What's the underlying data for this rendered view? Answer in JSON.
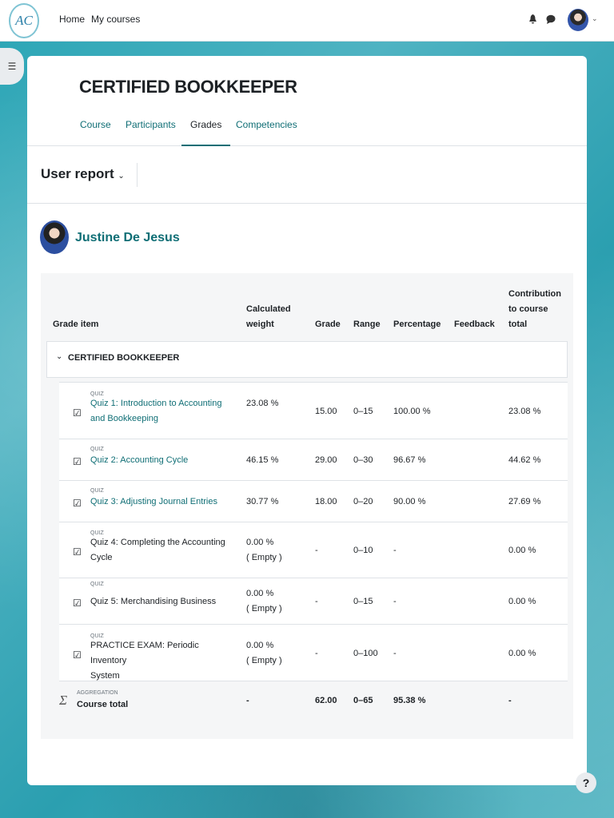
{
  "nav": {
    "logo_text": "AC",
    "home": "Home",
    "my_courses": "My courses",
    "caret": "⌄"
  },
  "drawer_icon": "☰",
  "course": {
    "title": "CERTIFIED BOOKKEEPER",
    "tabs": [
      "Course",
      "Participants",
      "Grades",
      "Competencies"
    ],
    "active_tab": "Grades"
  },
  "report": {
    "label": "User report",
    "chevron": "⌄"
  },
  "user": {
    "name": "Justine De Jesus"
  },
  "table": {
    "headers": {
      "item": "Grade item",
      "weight": [
        "Calculated",
        "weight"
      ],
      "grade": "Grade",
      "range": "Range",
      "percentage": "Percentage",
      "feedback": "Feedback",
      "contribution": [
        "Contribution",
        "to course",
        "total"
      ]
    },
    "category": "CERTIFIED BOOKKEEPER",
    "rows": [
      {
        "type": "QUIZ",
        "name": [
          "Quiz 1: Introduction to Accounting",
          "and Bookkeeping"
        ],
        "link": true,
        "weight": [
          "23.08 %",
          ""
        ],
        "grade": "15.00",
        "range": "0–15",
        "percentage": "100.00 %",
        "feedback": "",
        "contribution": "23.08 %"
      },
      {
        "type": "QUIZ",
        "name": [
          "Quiz 2: Accounting Cycle",
          ""
        ],
        "link": true,
        "weight": [
          "46.15 %",
          ""
        ],
        "grade": "29.00",
        "range": "0–30",
        "percentage": "96.67 %",
        "feedback": "",
        "contribution": "44.62 %"
      },
      {
        "type": "QUIZ",
        "name": [
          "Quiz 3: Adjusting Journal Entries",
          ""
        ],
        "link": true,
        "weight": [
          "30.77 %",
          ""
        ],
        "grade": "18.00",
        "range": "0–20",
        "percentage": "90.00 %",
        "feedback": "",
        "contribution": "27.69 %"
      },
      {
        "type": "QUIZ",
        "name": [
          "Quiz 4: Completing the Accounting",
          "Cycle"
        ],
        "link": false,
        "weight": [
          "0.00 %",
          "( Empty )"
        ],
        "grade": "-",
        "range": "0–10",
        "percentage": "-",
        "feedback": "",
        "contribution": "0.00 %"
      },
      {
        "type": "QUIZ",
        "name": [
          "Quiz 5: Merchandising Business",
          ""
        ],
        "link": false,
        "weight": [
          "0.00 %",
          "( Empty )"
        ],
        "grade": "-",
        "range": "0–15",
        "percentage": "-",
        "feedback": "",
        "contribution": "0.00 %"
      },
      {
        "type": "QUIZ",
        "name": [
          "PRACTICE EXAM: Periodic Inventory",
          "System"
        ],
        "link": false,
        "weight": [
          "0.00 %",
          "( Empty )"
        ],
        "grade": "-",
        "range": "0–100",
        "percentage": "-",
        "feedback": "",
        "contribution": "0.00 %"
      }
    ],
    "total": {
      "type": "AGGREGATION",
      "name": "Course total",
      "weight": "-",
      "grade": "62.00",
      "range": "0–65",
      "percentage": "95.38 %",
      "contribution": "-"
    }
  },
  "help": "?"
}
